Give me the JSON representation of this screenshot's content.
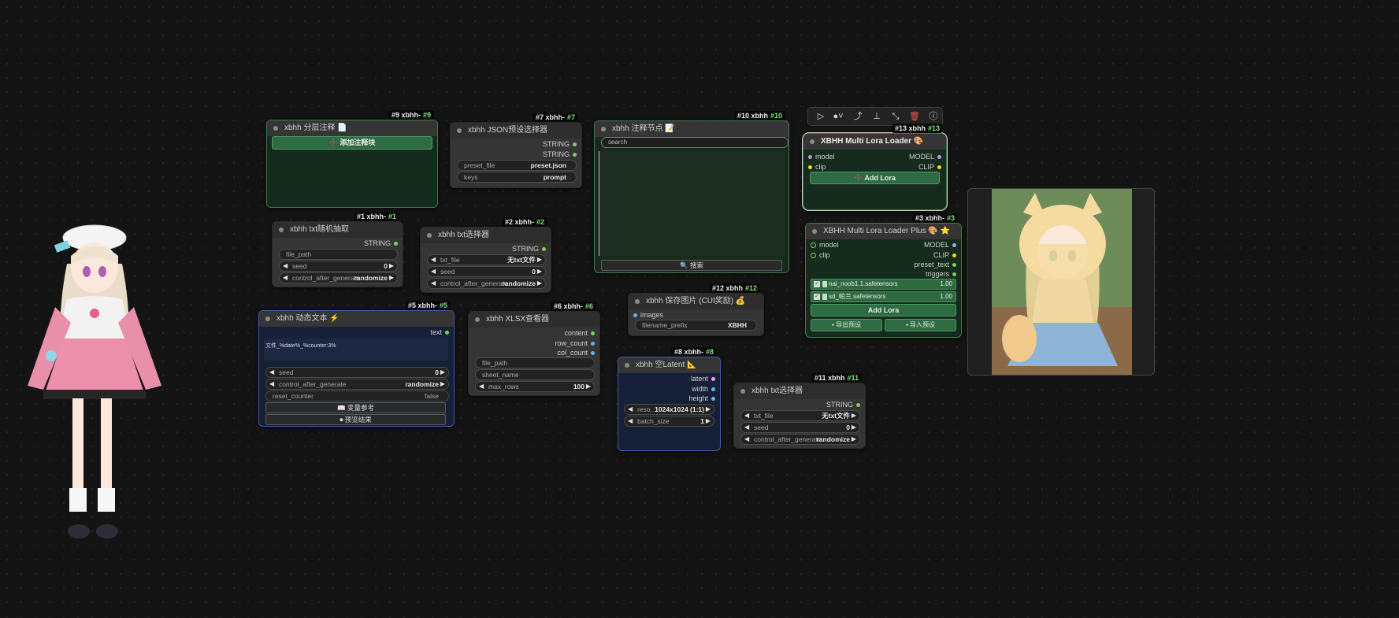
{
  "toolbar": {
    "icons": [
      "play-icon",
      "color-icon",
      "link-icon",
      "pin-icon",
      "collapse-icon",
      "delete-icon",
      "help-icon"
    ]
  },
  "nodes": {
    "n9": {
      "badge": "#9 xbhh-",
      "id": "#9",
      "title": "xbhh 分层注释 📄",
      "button": "➕ 添加注释块"
    },
    "n7": {
      "badge": "#7 xbhh-",
      "id": "#7",
      "title": "xbhh JSON预设选择器",
      "outputs": [
        "STRING",
        "STRING"
      ],
      "widgets": [
        {
          "label": "preset_file",
          "value": "preset.json"
        },
        {
          "label": "keys",
          "value": "prompt"
        }
      ]
    },
    "n10": {
      "badge": "#10 xbhh",
      "id": "#10",
      "title": "xbhh 注释节点 📝",
      "search_placeholder": "search",
      "button": "🔍 搜索"
    },
    "n13": {
      "badge": "#13 xbhh",
      "id": "#13",
      "title": "XBHH Multi Lora Loader 🎨",
      "inputs": [
        "model",
        "clip"
      ],
      "outputs": [
        "MODEL",
        "CLIP"
      ],
      "button": "➕ Add Lora"
    },
    "n1": {
      "badge": "#1 xbhh-",
      "id": "#1",
      "title": "xbhh txt随机抽取",
      "output": "STRING",
      "widgets": [
        {
          "label": "file_path",
          "value": ""
        },
        {
          "label": "seed",
          "value": "0"
        },
        {
          "label": "control_after_generate",
          "value": "randomize"
        }
      ]
    },
    "n2": {
      "badge": "#2 xbhh-",
      "id": "#2",
      "title": "xbhh txt选择器",
      "output": "STRING",
      "widgets": [
        {
          "label": "txt_file",
          "value": "无txt文件"
        },
        {
          "label": "seed",
          "value": "0"
        },
        {
          "label": "control_after_generate",
          "value": "randomize"
        }
      ]
    },
    "n3": {
      "badge": "#3 xbhh-",
      "id": "#3",
      "title": "XBHH Multi Lora Loader Plus 🎨 ⭐",
      "inputs": [
        "model",
        "clip"
      ],
      "outputs": [
        "MODEL",
        "CLIP",
        "preset_text",
        "triggers"
      ],
      "loras": [
        {
          "name": "nai_noob1.1.safetensors",
          "strength": "1.00"
        },
        {
          "name": "sd_帕兰.safetensors",
          "strength": "1.00"
        }
      ],
      "add_button": "Add Lora",
      "export_button": "导出预设",
      "import_button": "导入预设"
    },
    "n12": {
      "badge": "#12 xbhh",
      "id": "#12",
      "title": "xbhh 保存图片 (CUI奖励) 💰",
      "input": "images",
      "widgets": [
        {
          "label": "filename_prefix",
          "value": "XBHH"
        }
      ]
    },
    "n5": {
      "badge": "#5 xbhh-",
      "id": "#5",
      "title": "xbhh 动态文本 ⚡",
      "output": "text",
      "text_content": "文件_%date%_%counter:3%",
      "widgets": [
        {
          "label": "seed",
          "value": "0"
        },
        {
          "label": "control_after_generate",
          "value": "randomize"
        },
        {
          "label": "reset_counter",
          "value": "false"
        }
      ],
      "button1": "📖 变量参考",
      "button2": "⏺ 预览结果"
    },
    "n6": {
      "badge": "#6 xbhh-",
      "id": "#6",
      "title": "xbhh XLSX查看器",
      "outputs": [
        "content",
        "row_count",
        "col_count"
      ],
      "widgets": [
        {
          "label": "file_path",
          "value": ""
        },
        {
          "label": "sheet_name",
          "value": ""
        },
        {
          "label": "max_rows",
          "value": "100"
        }
      ]
    },
    "n8": {
      "badge": "#8 xbhh-",
      "id": "#8",
      "title": "xbhh 空Latent 📐",
      "outputs": [
        "latent",
        "width",
        "height"
      ],
      "widgets": [
        {
          "label": "reso...",
          "value": "1024x1024 (1:1)"
        },
        {
          "label": "batch_size",
          "value": "1"
        }
      ]
    },
    "n11": {
      "badge": "#11 xbhh",
      "id": "#11",
      "title": "xbhh txt选择器",
      "output": "STRING",
      "widgets": [
        {
          "label": "txt_file",
          "value": "无txt文件"
        },
        {
          "label": "seed",
          "value": "0"
        },
        {
          "label": "control_after_generate",
          "value": "randomize"
        }
      ]
    }
  }
}
